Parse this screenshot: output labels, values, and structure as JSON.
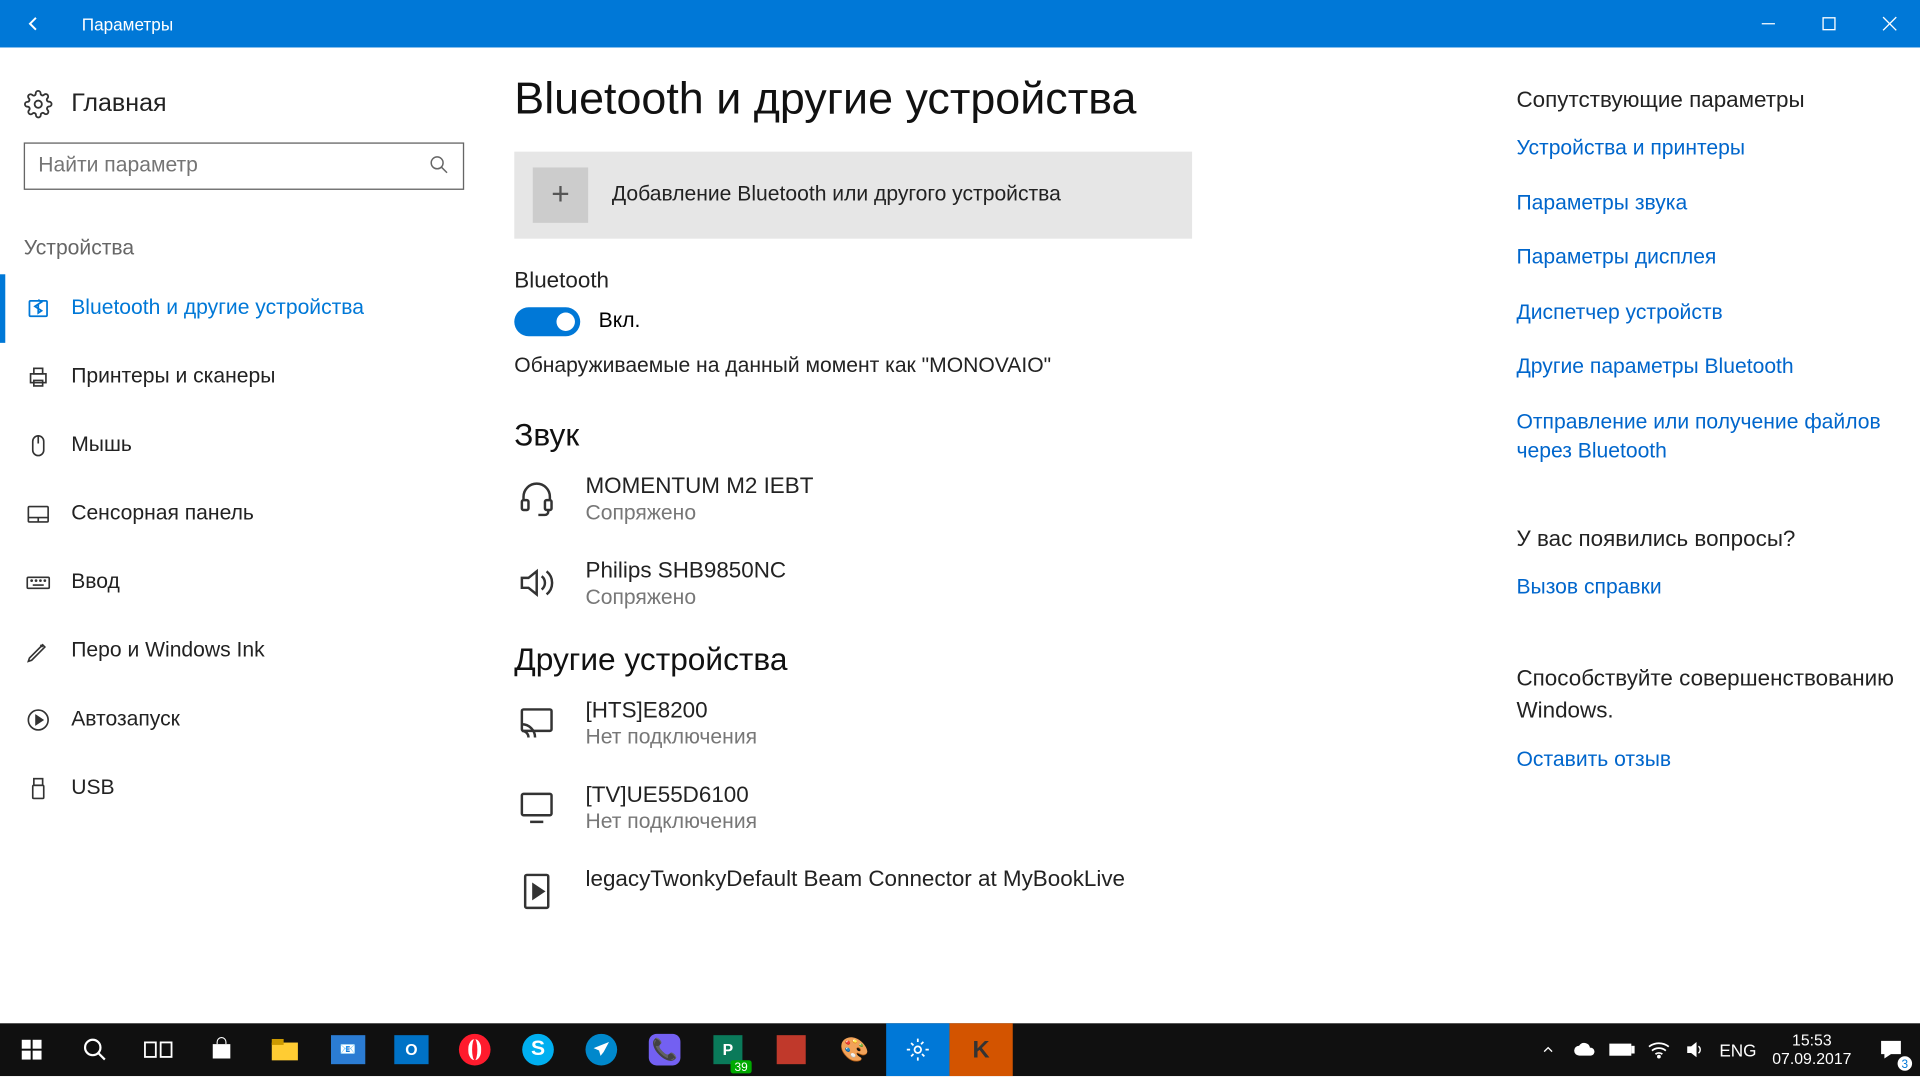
{
  "titlebar": {
    "title": "Параметры"
  },
  "home": {
    "label": "Главная"
  },
  "search": {
    "placeholder": "Найти параметр"
  },
  "nav_group": "Устройства",
  "nav": [
    {
      "label": "Bluetooth и другие устройства",
      "active": true
    },
    {
      "label": "Принтеры и сканеры"
    },
    {
      "label": "Мышь"
    },
    {
      "label": "Сенсорная панель"
    },
    {
      "label": "Ввод"
    },
    {
      "label": "Перо и Windows Ink"
    },
    {
      "label": "Автозапуск"
    },
    {
      "label": "USB"
    }
  ],
  "main": {
    "title": "Bluetooth и другие устройства",
    "add": "Добавление Bluetooth или другого устройства",
    "bt_label": "Bluetooth",
    "bt_state": "Вкл.",
    "discoverable": "Обнаруживаемые на данный момент как \"MONOVAIO\"",
    "audio_h": "Звук",
    "audio": [
      {
        "name": "MOMENTUM M2 IEBT",
        "status": "Сопряжено"
      },
      {
        "name": "Philips SHB9850NC",
        "status": "Сопряжено"
      }
    ],
    "other_h": "Другие устройства",
    "other": [
      {
        "name": "[HTS]E8200",
        "status": "Нет подключения"
      },
      {
        "name": "[TV]UE55D6100",
        "status": "Нет подключения"
      },
      {
        "name": "legacyTwonkyDefault Beam Connector at MyBookLive",
        "status": ""
      }
    ]
  },
  "right": {
    "related_h": "Сопутствующие параметры",
    "related": [
      "Устройства и принтеры",
      "Параметры звука",
      "Параметры дисплея",
      "Диспетчер устройств",
      "Другие параметры Bluetooth",
      "Отправление или получение файлов через Bluetooth"
    ],
    "help_h": "У вас появились вопросы?",
    "help_link": "Вызов справки",
    "fb_h": "Способствуйте совершенствованию Windows.",
    "fb_link": "Оставить отзыв"
  },
  "taskbar": {
    "lang": "ENG",
    "time": "15:53",
    "date": "07.09.2017",
    "badge": "39",
    "notif": "3"
  }
}
